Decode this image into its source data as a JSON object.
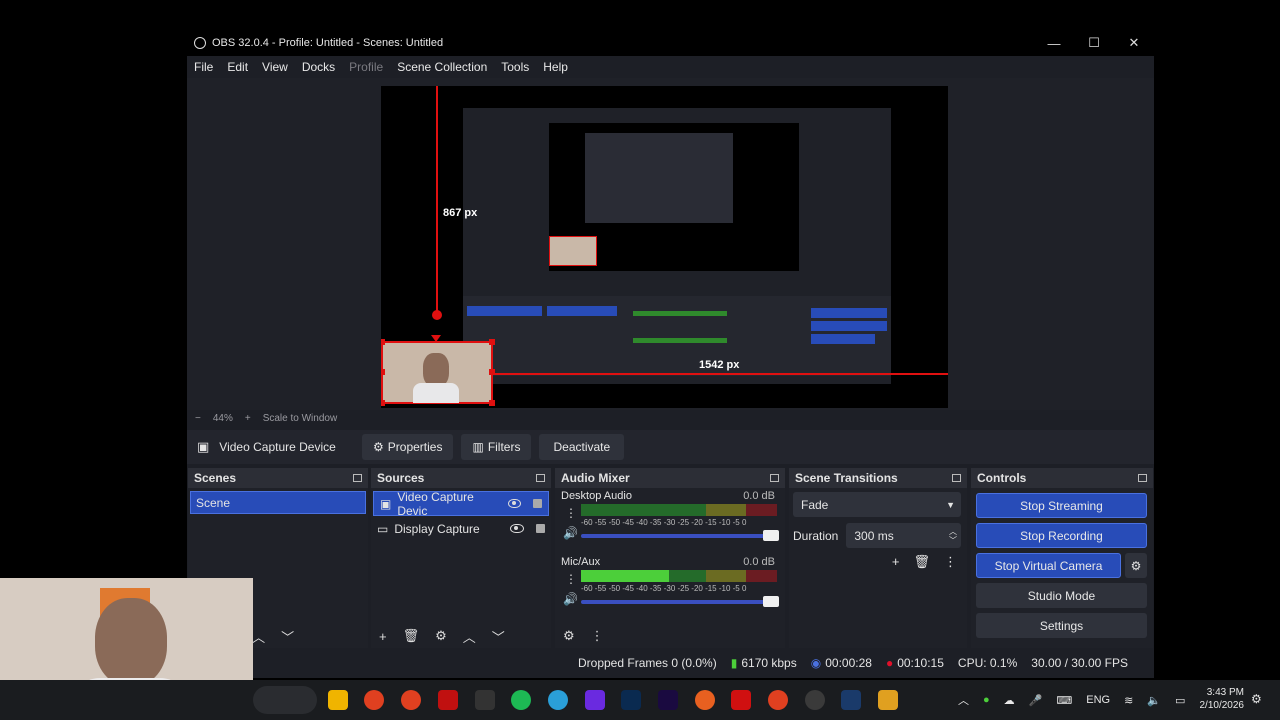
{
  "window": {
    "title": "OBS 32.0.4 - Profile: Untitled - Scenes: Untitled",
    "minimize": "—",
    "maximize": "☐",
    "close": "✕"
  },
  "menu": [
    "File",
    "Edit",
    "View",
    "Docks",
    "Profile",
    "Scene Collection",
    "Tools",
    "Help"
  ],
  "preview": {
    "measure_height": "867 px",
    "measure_width": "1542 px",
    "zoom": "44%",
    "zoom_minus": "−",
    "zoom_plus": "+",
    "scale_mode": "Scale to Window"
  },
  "source_toolbar": {
    "selected_source": "Video Capture Device",
    "properties": "Properties",
    "filters": "Filters",
    "deactivate": "Deactivate"
  },
  "scenes": {
    "title": "Scenes",
    "items": [
      "Scene"
    ]
  },
  "sources": {
    "title": "Sources",
    "items": [
      "Video Capture Devic",
      "Display Capture"
    ]
  },
  "audio_mixer": {
    "title": "Audio Mixer",
    "channels": [
      {
        "name": "Desktop Audio",
        "db": "0.0 dB",
        "level": 0
      },
      {
        "name": "Mic/Aux",
        "db": "0.0 dB",
        "level": 0.45
      }
    ],
    "scale": "-60 -55 -50 -45 -40 -35 -30 -25 -20 -15 -10 -5 0"
  },
  "scene_transitions": {
    "title": "Scene Transitions",
    "transition": "Fade",
    "duration_label": "Duration",
    "duration": "300 ms"
  },
  "controls": {
    "title": "Controls",
    "stop_streaming": "Stop Streaming",
    "stop_recording": "Stop Recording",
    "stop_virtual_camera": "Stop Virtual Camera",
    "studio_mode": "Studio Mode",
    "settings": "Settings"
  },
  "status": {
    "dropped_frames": "Dropped Frames 0 (0.0%)",
    "bitrate": "6170 kbps",
    "stream_time": "00:00:28",
    "record_time": "00:10:15",
    "cpu": "CPU: 0.1%",
    "fps": "30.00 / 30.00 FPS"
  },
  "taskbar": {
    "language": "ENG",
    "time": "3:43 PM",
    "date": "2/10/2026"
  },
  "colors": {
    "accent": "#284cb8",
    "record": "#e0102a",
    "guide": "#e01010"
  }
}
